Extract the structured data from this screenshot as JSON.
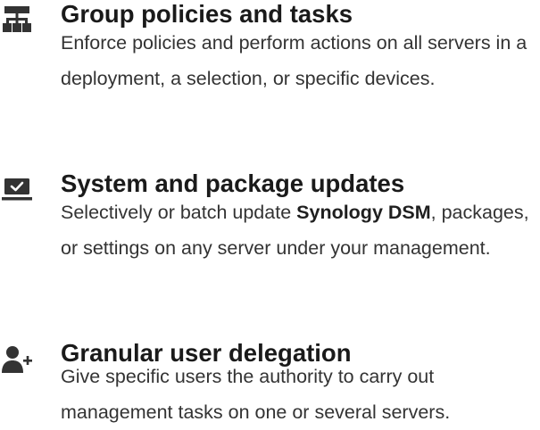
{
  "features": [
    {
      "icon": "server-network-icon",
      "title": "Group policies and tasks",
      "description": "Enforce policies and perform actions on all servers in a deployment, a selection, or specific devices."
    },
    {
      "icon": "checkbox-monitor-icon",
      "title": "System and package updates",
      "description_before": "Selectively or batch update ",
      "description_bold": "Synology DSM",
      "description_after": ", packages, or settings on any server under your management."
    },
    {
      "icon": "user-add-icon",
      "title": "Granular user delegation",
      "description": "Give specific users the authority to carry out management tasks on one or several servers."
    }
  ],
  "colors": {
    "icon": "#333333",
    "text": "#333333",
    "title": "#1a1a1a"
  }
}
